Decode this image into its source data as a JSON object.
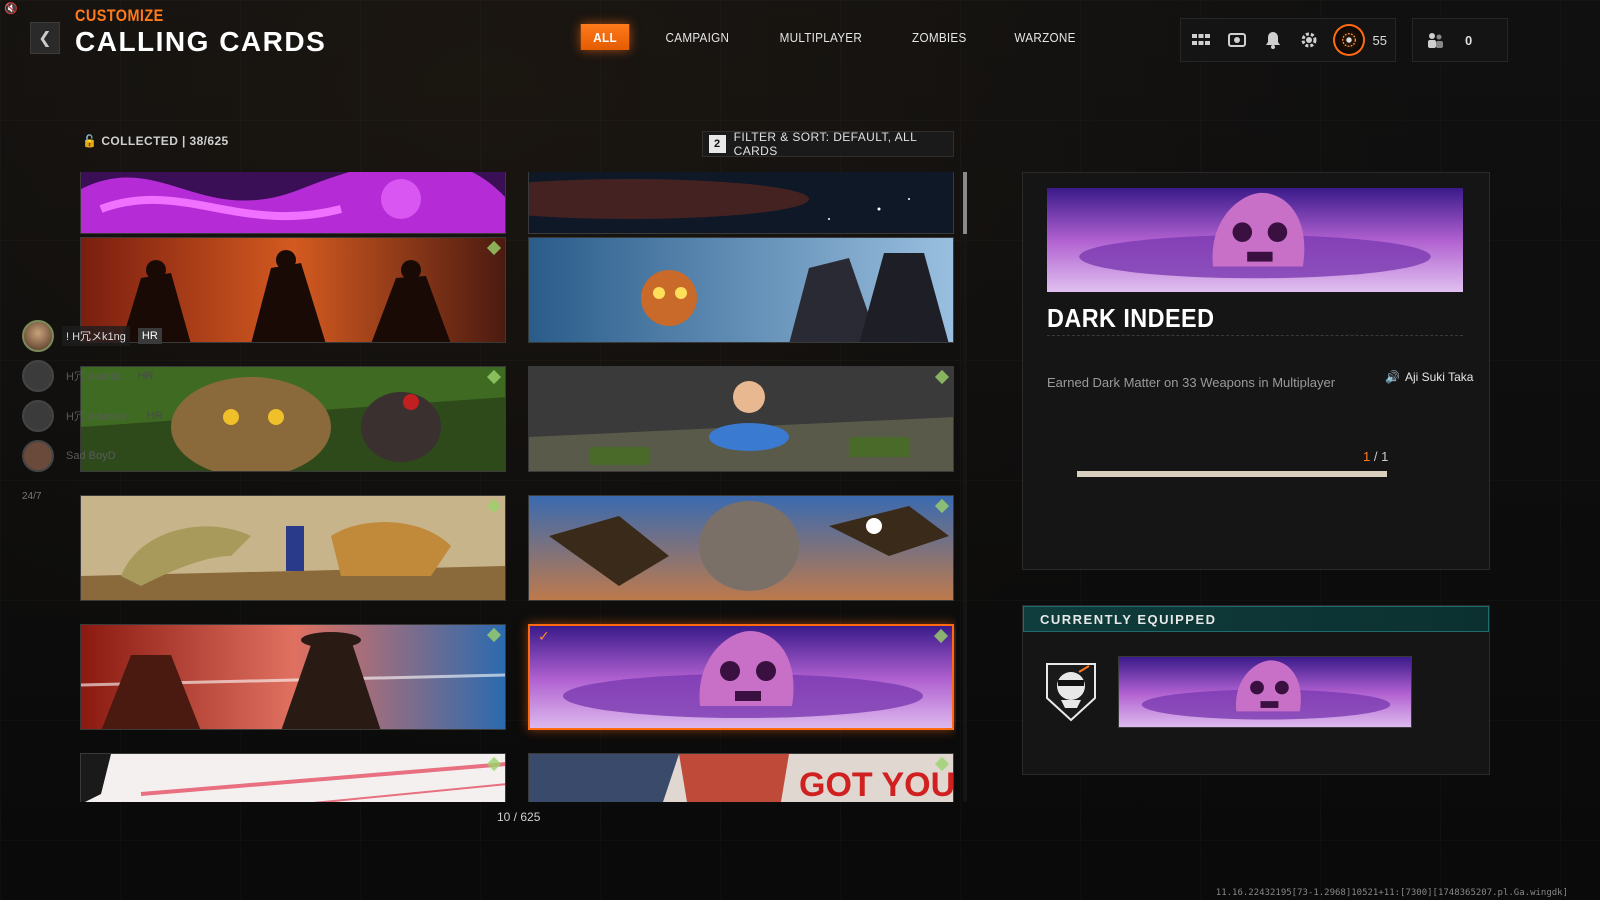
{
  "header": {
    "breadcrumb": "CUSTOMIZE",
    "title": "CALLING CARDS",
    "tabs": [
      "ALL",
      "CAMPAIGN",
      "MULTIPLAYER",
      "ZOMBIES",
      "WARZONE"
    ],
    "active_tab": "ALL"
  },
  "top_bar": {
    "icons": [
      "apps-grid-icon",
      "theater-icon",
      "notification-bell-icon",
      "settings-gear-icon"
    ],
    "rank_level": "55",
    "friends_online": "0"
  },
  "collection": {
    "collected_label": "COLLECTED | 38/625",
    "filter_key": "2",
    "filter_label": "FILTER & SORT: DEFAULT, ALL CARDS",
    "page_counter": "10 / 625"
  },
  "cards": [
    {
      "name": "purple-tentacle-card",
      "theme": "purple-tentacles",
      "selected": false
    },
    {
      "name": "night-sky-card",
      "theme": "night-sky",
      "selected": false
    },
    {
      "name": "dark-riders-card",
      "theme": "riders",
      "selected": false
    },
    {
      "name": "snow-zombie-card",
      "theme": "snow-zombie",
      "selected": false
    },
    {
      "name": "cat-and-rat-card",
      "theme": "cat-rat",
      "selected": false
    },
    {
      "name": "cereal-kid-card",
      "theme": "cereal",
      "selected": false
    },
    {
      "name": "croc-vs-lion-card",
      "theme": "croc-lion",
      "selected": false
    },
    {
      "name": "eagles-rock-golem-card",
      "theme": "eagles",
      "selected": false
    },
    {
      "name": "gunslinger-card",
      "theme": "gunslinger",
      "selected": false
    },
    {
      "name": "dark-indeed-card",
      "theme": "dark-skull",
      "selected": true
    },
    {
      "name": "white-splatter-card",
      "theme": "white-splatter",
      "selected": false
    },
    {
      "name": "got-your-card",
      "theme": "comic",
      "selected": false
    }
  ],
  "social": {
    "players": [
      {
        "name": "! H冗メk1ng",
        "tag": "HR"
      },
      {
        "name": "H冗メsmitz",
        "tag": "HR"
      },
      {
        "name": "H冗メAmaan",
        "tag": "HR"
      },
      {
        "name": "Sad BoyD",
        "tag": ""
      }
    ],
    "status_247": "24/7"
  },
  "detail": {
    "name": "DARK INDEED",
    "description": "Earned Dark Matter on 33 Weapons in Multiplayer",
    "artist": "Aji Suki Taka",
    "progress_current": "1",
    "progress_total": "/ 1",
    "progress_fraction": 1.0
  },
  "equipped": {
    "header": "CURRENTLY EQUIPPED"
  },
  "build_info": "11.16.22432195[73-1.2968]10521+11:[7300][1748365207.pl.Ga.wingdk]",
  "colors": {
    "accent": "#ff6a10",
    "equipped_header": "#0f3c3c"
  }
}
